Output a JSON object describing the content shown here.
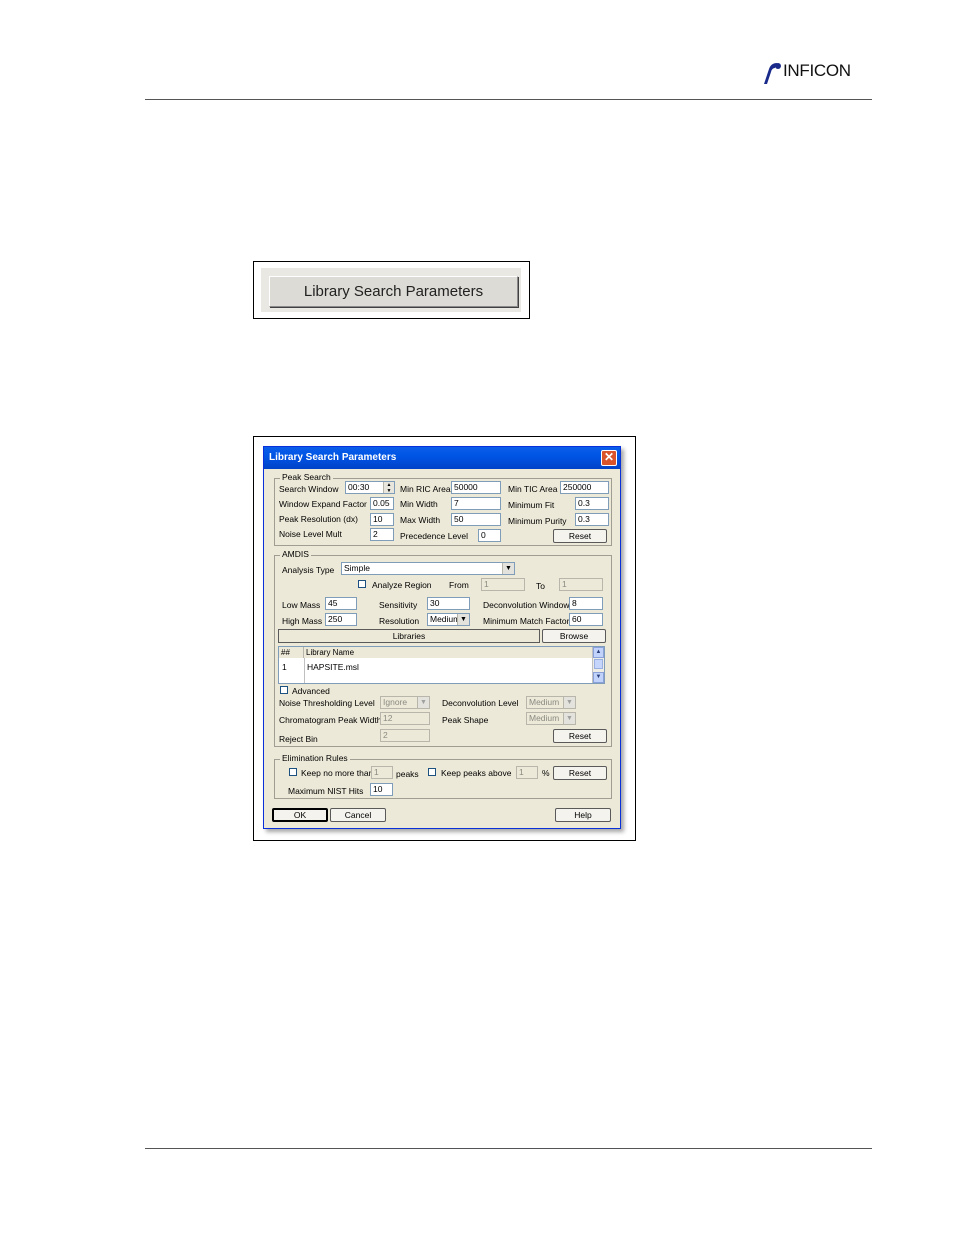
{
  "header": {
    "brand": "INFICON"
  },
  "figure1": {
    "button_label": "Library Search Parameters"
  },
  "dialog": {
    "title": "Library Search Parameters",
    "close_glyph": "✕",
    "peak_search": {
      "group_label": "Peak Search",
      "search_window_label": "Search Window",
      "search_window": "00:30",
      "window_expand_label": "Window Expand Factor",
      "window_expand": "0.05",
      "peak_resolution_label": "Peak Resolution (dx)",
      "peak_resolution": "10",
      "noise_level_label": "Noise Level Mult",
      "noise_level": "2",
      "min_ric_label": "Min RIC Area",
      "min_ric": "50000",
      "min_width_label": "Min Width",
      "min_width": "7",
      "max_width_label": "Max Width",
      "max_width": "50",
      "precedence_label": "Precedence Level",
      "precedence": "0",
      "min_tic_label": "Min TIC Area",
      "min_tic": "250000",
      "min_fit_label": "Minimum Fit",
      "min_fit": "0.3",
      "min_purity_label": "Minimum Purity",
      "min_purity": "0.3",
      "reset_label": "Reset"
    },
    "amdis": {
      "group_label": "AMDIS",
      "analysis_type_label": "Analysis Type",
      "analysis_type": "Simple",
      "analyze_region_label": "Analyze Region",
      "from_label": "From",
      "from_value": "1",
      "to_label": "To",
      "to_value": "1",
      "low_mass_label": "Low Mass",
      "low_mass": "45",
      "high_mass_label": "High Mass",
      "high_mass": "250",
      "sensitivity_label": "Sensitivity",
      "sensitivity": "30",
      "resolution_label": "Resolution",
      "resolution": "Medium",
      "deconv_window_label": "Deconvolution Window",
      "deconv_window": "8",
      "min_match_label": "Minimum Match Factor",
      "min_match": "60",
      "libraries_label": "Libraries",
      "browse_label": "Browse",
      "table": {
        "columns": [
          "##",
          "Library Name"
        ],
        "rows": [
          [
            "1",
            "HAPSITE.msl"
          ]
        ]
      },
      "advanced_label": "Advanced",
      "noise_thresh_label": "Noise Thresholding Level",
      "noise_thresh": "Ignore",
      "chrom_peak_width_label": "Chromatogram Peak Width",
      "chrom_peak_width": "12",
      "reject_bin_label": "Reject Bin",
      "reject_bin": "2",
      "deconv_level_label": "Deconvolution Level",
      "deconv_level": "Medium",
      "peak_shape_label": "Peak Shape",
      "peak_shape": "Medium",
      "reset_label": "Reset"
    },
    "elimination": {
      "group_label": "Elimination Rules",
      "keep_no_more_label": "Keep no more than",
      "keep_no_more": "1",
      "peaks_label": "peaks",
      "keep_above_label": "Keep peaks above",
      "keep_above": "1",
      "percent_label": "%",
      "max_nist_label": "Maximum NIST Hits",
      "max_nist": "10",
      "reset_label": "Reset"
    },
    "footer": {
      "ok_label": "OK",
      "cancel_label": "Cancel",
      "help_label": "Help"
    }
  }
}
